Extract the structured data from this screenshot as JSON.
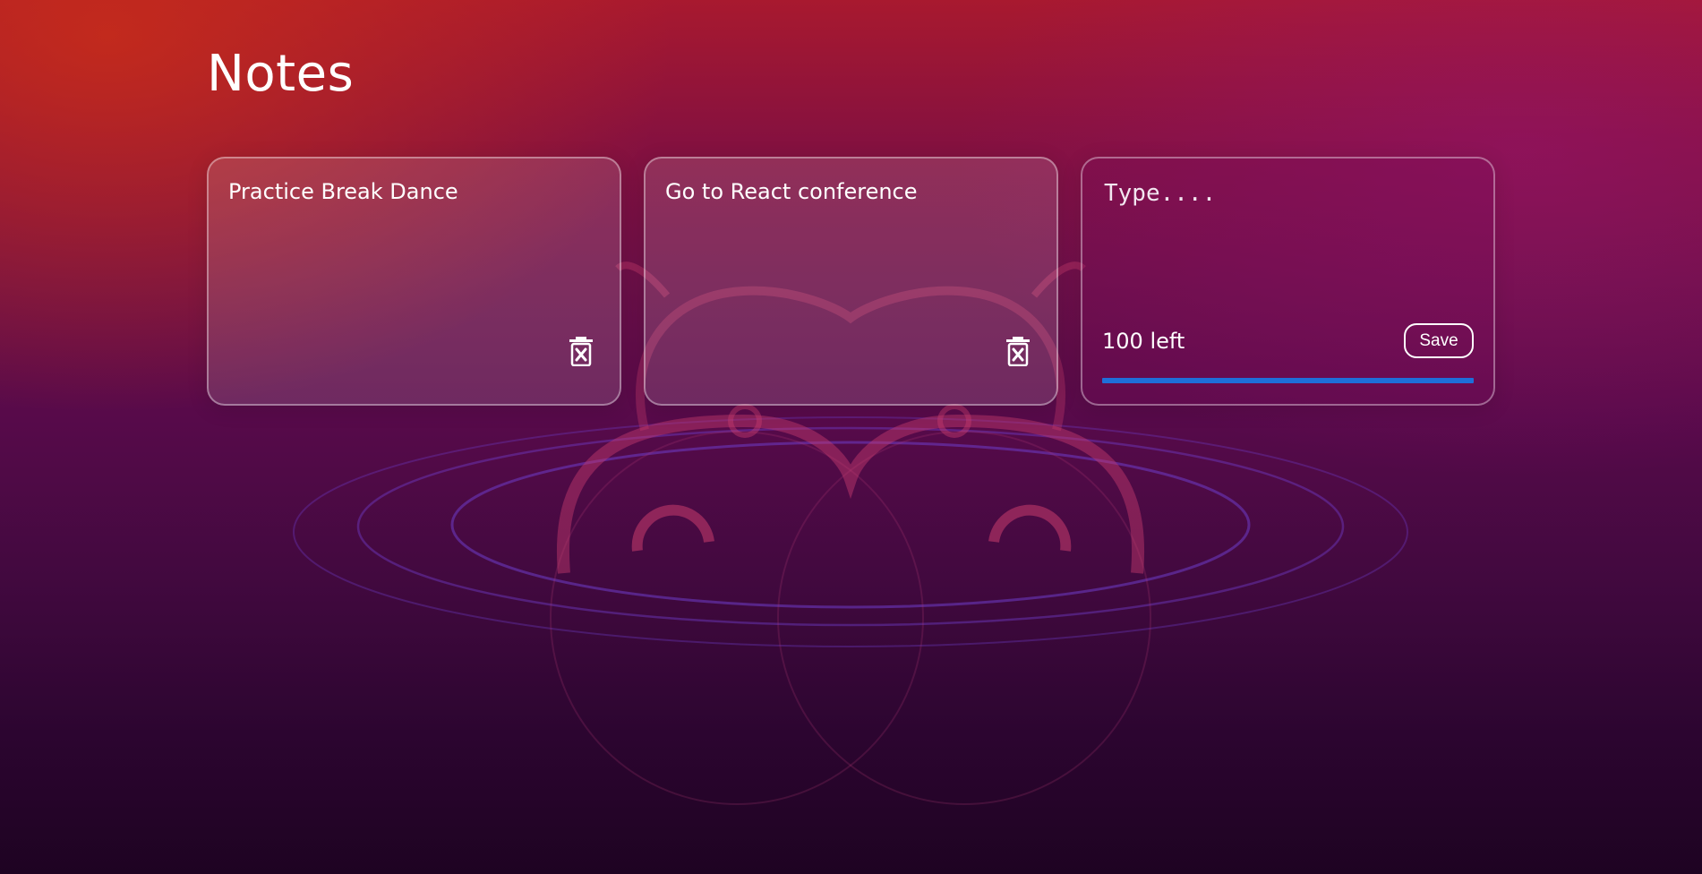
{
  "header": {
    "title": "Notes"
  },
  "notes": [
    {
      "text": "Practice Break Dance",
      "delete_icon": "trash-icon"
    },
    {
      "text": "Go to React conference",
      "delete_icon": "trash-icon"
    }
  ],
  "new_note": {
    "placeholder": "Type....",
    "chars_left_label": "100 left",
    "save_label": "Save",
    "progress_fraction": 1.0
  },
  "colors": {
    "accent": "#1e6fd9",
    "text": "#ffffff"
  }
}
